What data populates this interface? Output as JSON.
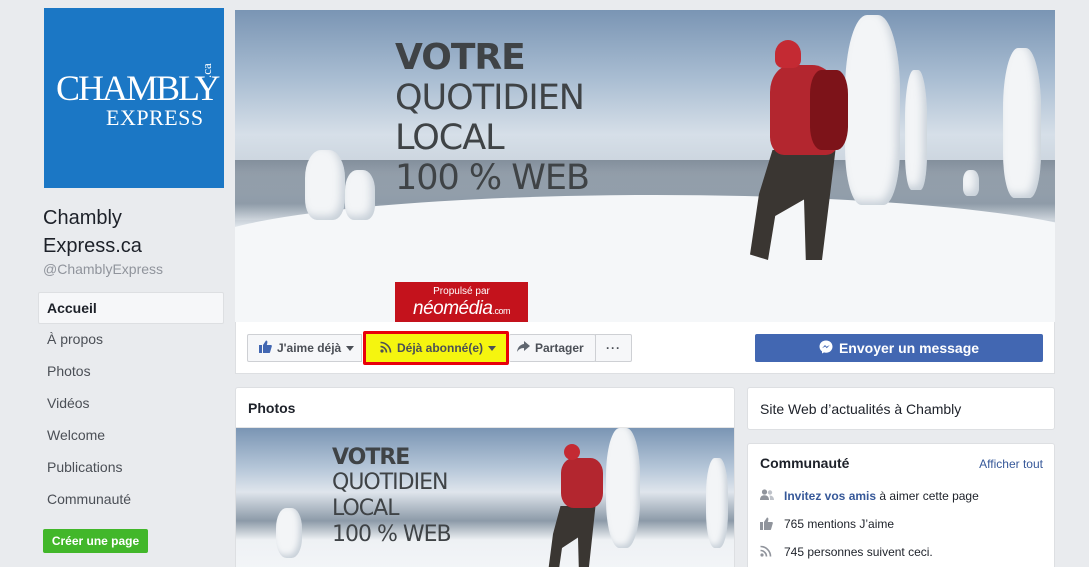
{
  "page": {
    "logo": {
      "line1": "CHAMBLY",
      "sup": ".ca",
      "line2": "EXPRESS",
      "color": "#1b77c5"
    },
    "name": "Chambly Express.ca",
    "handle": "@ChamblyExpress"
  },
  "nav": {
    "items": [
      {
        "label": "Accueil",
        "active": true
      },
      {
        "label": "À propos"
      },
      {
        "label": "Photos"
      },
      {
        "label": "Vidéos"
      },
      {
        "label": "Welcome"
      },
      {
        "label": "Publications"
      },
      {
        "label": "Communauté"
      }
    ],
    "create_page": "Créer une page"
  },
  "cover": {
    "line1": "VOTRE",
    "line2": "QUOTIDIEN",
    "line3": "LOCAL",
    "line4": "100 % WEB",
    "sponsor_top": "Propulsé par",
    "sponsor_name": "néomédia",
    "sponsor_suffix": ".com"
  },
  "actions": {
    "like": "J'aime déjà",
    "subscribe": "Déjà abonné(e)",
    "share": "Partager",
    "more": "···",
    "message": "Envoyer un message",
    "highlight_color": "#e8000a",
    "subscribe_bg": "#f5f50f"
  },
  "photos": {
    "title": "Photos",
    "thumb": {
      "line1": "VOTRE",
      "line2": "QUOTIDIEN",
      "line3": "LOCAL",
      "line4": "100 % WEB"
    }
  },
  "about": {
    "text": "Site Web d’actualités à Chambly"
  },
  "community": {
    "title": "Communauté",
    "see_all": "Afficher tout",
    "invite_link": "Invitez vos amis",
    "invite_rest": " à aimer cette page",
    "likes": "765 mentions J’aime",
    "followers": "745 personnes suivent ceci."
  }
}
